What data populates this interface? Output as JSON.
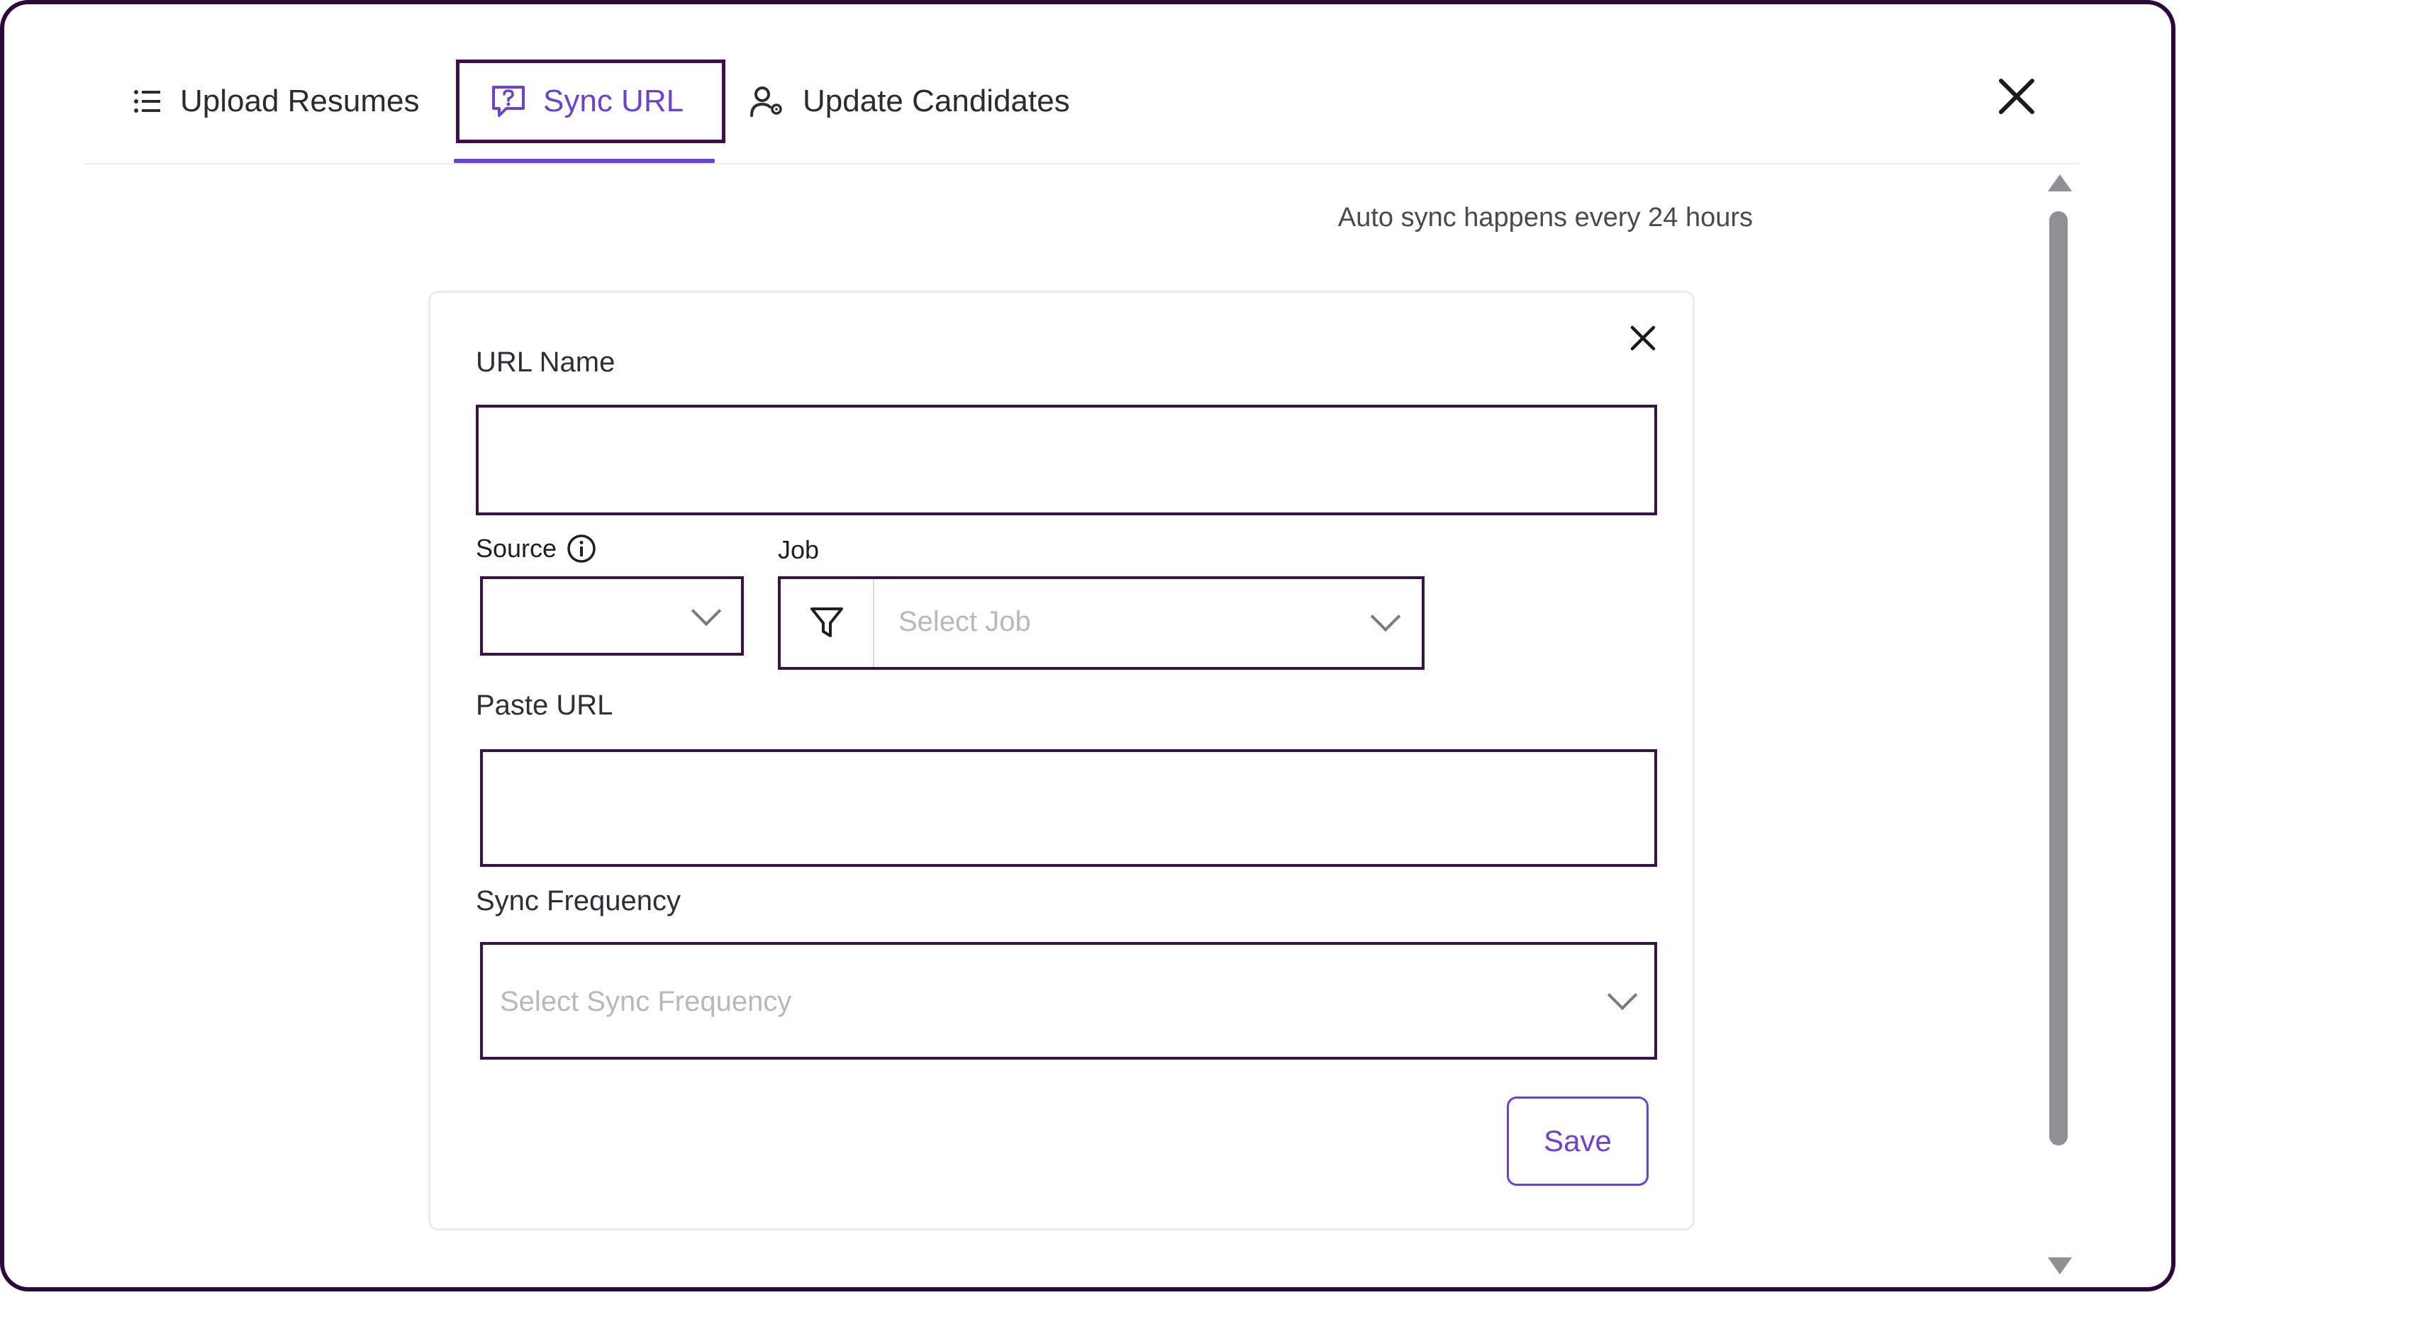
{
  "tabs": {
    "upload_label": "Upload Resumes",
    "sync_label": "Sync URL",
    "update_label": "Update Candidates",
    "active": "Sync URL"
  },
  "note": "Auto sync happens every 24 hours",
  "form": {
    "url_name_label": "URL Name",
    "url_name_value": "",
    "source_label": "Source",
    "source_value": "",
    "job_label": "Job",
    "job_placeholder": "Select Job",
    "paste_url_label": "Paste URL",
    "paste_url_value": "",
    "sync_frequency_label": "Sync Frequency",
    "sync_frequency_placeholder": "Select Sync Frequency",
    "save_label": "Save"
  },
  "colors": {
    "accent": "#6a43d6",
    "border_dark": "#3c0f4f"
  },
  "icons": {
    "upload_tab": "list-icon",
    "sync_tab": "question-chat-icon",
    "update_tab": "user-settings-icon",
    "source_info": "info-icon",
    "job_filter": "filter-icon"
  }
}
